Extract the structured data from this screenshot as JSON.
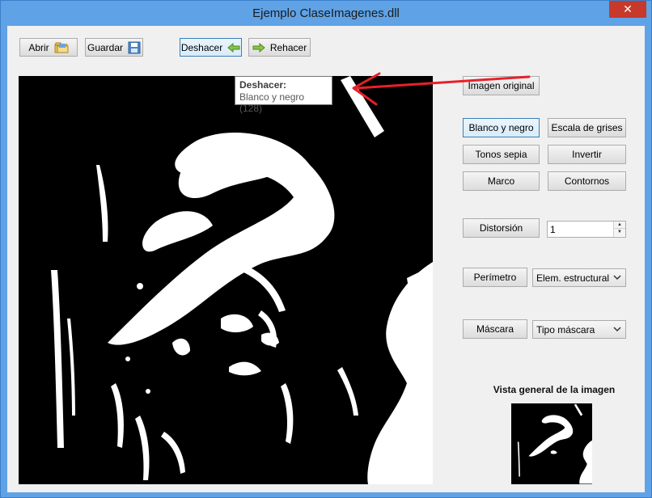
{
  "window": {
    "title": "Ejemplo ClaseImagenes.dll",
    "close_label": "✕"
  },
  "toolbar": {
    "open_label": "Abrir",
    "save_label": "Guardar",
    "undo_label": "Deshacer",
    "redo_label": "Rehacer",
    "icons": [
      "folder-icon",
      "save-icon",
      "left-arrow-icon",
      "right-arrow-icon"
    ]
  },
  "tooltip": {
    "title": "Deshacer:",
    "text": "Blanco y negro (128)"
  },
  "filters": {
    "original_label": "Imagen original",
    "bw_label": "Blanco y negro",
    "grayscale_label": "Escala de grises",
    "sepia_label": "Tonos sepia",
    "invert_label": "Invertir",
    "frame_label": "Marco",
    "contours_label": "Contornos",
    "distortion_label": "Distorsión",
    "distortion_value": "1",
    "perimeter_label": "Perímetro",
    "structural_element_option": "Elem. estructural",
    "mask_label": "Máscara",
    "mask_type_option": "Tipo máscara"
  },
  "overview": {
    "label": "Vista general de la imagen"
  },
  "colors": {
    "title_bar": "#5fa2e6",
    "client_bg": "#f0f0f0",
    "close_button": "#c7392b",
    "annotation_arrow": "#e8202a"
  }
}
